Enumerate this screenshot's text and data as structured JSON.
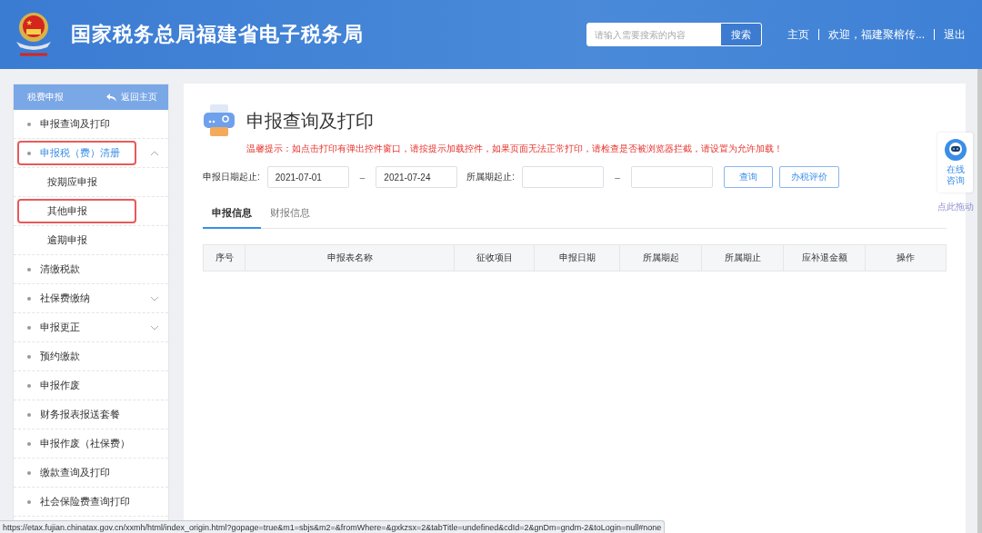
{
  "header": {
    "title": "国家税务总局福建省电子税务局",
    "search": {
      "placeholder": "请输入需要搜索的内容",
      "button": "搜索"
    },
    "links": [
      "主页",
      "欢迎，福建聚榕传...",
      "退出"
    ]
  },
  "sidebar": {
    "title": "税费申报",
    "back": "返回主页",
    "items": [
      {
        "label": "申报查询及打印",
        "selected": false,
        "highlighted": false
      },
      {
        "label": "申报税（费）清册",
        "selected": true,
        "highlighted": true,
        "expanded": true,
        "children": [
          {
            "label": "按期应申报",
            "highlighted": false
          },
          {
            "label": "其他申报",
            "highlighted": true
          },
          {
            "label": "逾期申报",
            "highlighted": false
          }
        ]
      },
      {
        "label": "清缴税款",
        "selected": false,
        "highlighted": false
      },
      {
        "label": "社保费缴纳",
        "selected": false,
        "highlighted": false,
        "expanded": false
      },
      {
        "label": "申报更正",
        "selected": false,
        "highlighted": false,
        "expanded": false
      },
      {
        "label": "预约缴款",
        "selected": false,
        "highlighted": false
      },
      {
        "label": "申报作废",
        "selected": false,
        "highlighted": false
      },
      {
        "label": "财务报表报送套餐",
        "selected": false,
        "highlighted": false
      },
      {
        "label": "申报作废（社保费）",
        "selected": false,
        "highlighted": false
      },
      {
        "label": "缴款查询及打印",
        "selected": false,
        "highlighted": false
      },
      {
        "label": "社会保险费查询打印",
        "selected": false,
        "highlighted": false
      }
    ]
  },
  "main": {
    "title": "申报查询及打印",
    "notice": "温馨提示：如点击打印有弹出控件窗口，请按提示加载控件，如果页面无法正常打印，请检查是否被浏览器拦截，请设置为允许加载！",
    "filters": [
      {
        "label": "申报日期起止:",
        "from": "2021-07-01",
        "to": "2021-07-24"
      },
      {
        "label": "所属期起止:"
      }
    ],
    "dash": "–",
    "buttons": [
      "查询",
      "办税评价"
    ],
    "tabs": [
      {
        "label": "申报信息",
        "selected": true
      },
      {
        "label": "财报信息",
        "selected": false
      }
    ],
    "table": {
      "columns": [
        "序号",
        "申报表名称",
        "征收项目",
        "申报日期",
        "所属期起",
        "所属期止",
        "应补退金额",
        "操作"
      ]
    }
  },
  "consult": {
    "label": "在线咨询",
    "drag": "点此拖动"
  },
  "status_bar": "https://etax.fujian.chinatax.gov.cn/xxmh/html/index_origin.html?gopage=true&m1=sbjs&m2=&fromWhere=&gxkzsx=2&tabTitle=undefined&cdId=2&gnDm=gndm-2&toLogin=null#none"
}
